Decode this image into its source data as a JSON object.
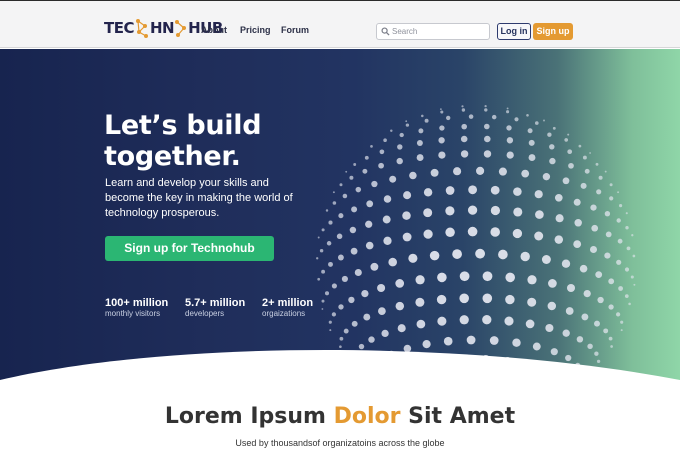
{
  "header": {
    "logo_text_left": "TEC",
    "logo_text_mid": "HN",
    "logo_text_right": "HUB",
    "nav": [
      "About",
      "Pricing",
      "Forum"
    ],
    "search_placeholder": "Search",
    "login_label": "Log in",
    "signup_label": "Sign up"
  },
  "hero": {
    "headline_line1": "Let’s build",
    "headline_line2": "together.",
    "subtext": "Learn and develop your skills and become the key in making the world of technology prosperous.",
    "cta_label": "Sign up for Technohub",
    "stats": [
      {
        "number": "100+ million",
        "label": "monthly visitors"
      },
      {
        "number": "5.7+ million",
        "label": "developers"
      },
      {
        "number": "2+ million",
        "label": "orgaizations"
      }
    ]
  },
  "section": {
    "title_part1": "Lorem Ipsum ",
    "title_accent": "Dolor",
    "title_part2": " Sit Amet",
    "subtitle": "Used by thousandsof organizatoins across the globe"
  },
  "colors": {
    "accent": "#e49a32",
    "cta": "#2bb673",
    "hero_dark": "#17244f",
    "hero_light": "#8fd6a8"
  },
  "icons": {
    "search": "search-icon",
    "logo_network": "network-icon"
  }
}
